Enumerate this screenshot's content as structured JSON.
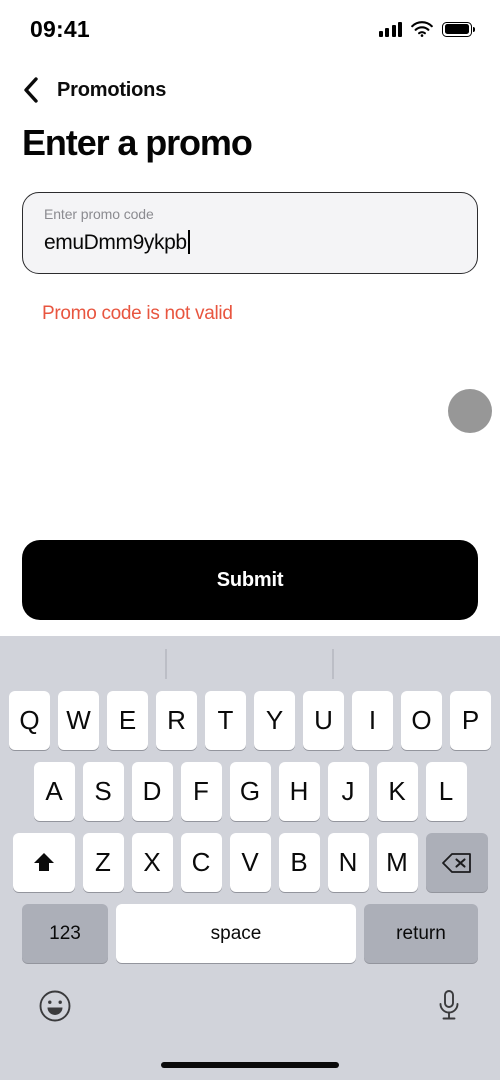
{
  "status_bar": {
    "time": "09:41",
    "signal_icon": "cellular-signal-icon",
    "wifi_icon": "wifi-icon",
    "battery_icon": "battery-full-icon"
  },
  "nav": {
    "back_icon": "chevron-left-icon",
    "title": "Promotions"
  },
  "page": {
    "title": "Enter a promo"
  },
  "promo_input": {
    "label": "Enter promo code",
    "value": "emuDmm9ykpb",
    "placeholder": "Enter promo code"
  },
  "error": {
    "message": "Promo code is not valid",
    "color": "#e8553f"
  },
  "floating_button": {
    "name": "floating-action-circle",
    "color": "#979797"
  },
  "submit": {
    "label": "Submit",
    "background": "#000000",
    "text_color": "#ffffff"
  },
  "keyboard": {
    "background": "#d1d3da",
    "key_color": "#ffffff",
    "function_key_color": "#acafb8",
    "suggestions": [
      "",
      "",
      ""
    ],
    "row1": [
      "Q",
      "W",
      "E",
      "R",
      "T",
      "Y",
      "U",
      "I",
      "O",
      "P"
    ],
    "row2": [
      "A",
      "S",
      "D",
      "F",
      "G",
      "H",
      "J",
      "K",
      "L"
    ],
    "row3_letters": [
      "Z",
      "X",
      "C",
      "V",
      "B",
      "N",
      "M"
    ],
    "shift_icon": "shift-arrow-icon",
    "backspace_icon": "backspace-delete-icon",
    "numbers_label": "123",
    "space_label": "space",
    "return_label": "return",
    "emoji_icon": "emoji-smiley-icon",
    "mic_icon": "microphone-icon"
  }
}
